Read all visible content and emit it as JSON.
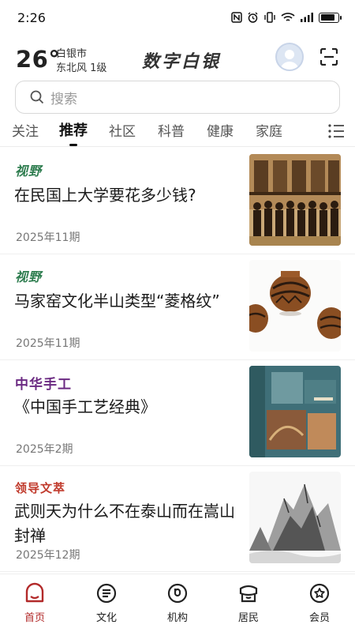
{
  "status_bar": {
    "time": "2:26",
    "icons": [
      "nfc-icon",
      "alarm-icon",
      "vibrate-icon",
      "wifi-icon",
      "signal-icon",
      "battery-icon"
    ]
  },
  "header": {
    "temperature": "26°",
    "city": "白银市",
    "wind": "东北风  1级",
    "brand": "数字白银",
    "avatar_icon": "avatar-icon",
    "scan_icon": "scan-icon"
  },
  "search": {
    "placeholder": "搜索"
  },
  "tabs": [
    {
      "label": "关注",
      "active": false
    },
    {
      "label": "推荐",
      "active": true
    },
    {
      "label": "社区",
      "active": false
    },
    {
      "label": "科普",
      "active": false
    },
    {
      "label": "健康",
      "active": false
    },
    {
      "label": "家庭",
      "active": false
    }
  ],
  "feed": [
    {
      "source": "视野",
      "source_color": "#2e7d4f",
      "title": "在民国上大学要花多少钱?",
      "date": "2025年11期",
      "thumb": "sepia-group-photo"
    },
    {
      "source": "视野",
      "source_color": "#2e7d4f",
      "title": "马家窑文化半山类型“菱格纹”",
      "date": "2025年11期",
      "thumb": "pottery-jars"
    },
    {
      "source": "中华手工",
      "source_color": "#6b2a82",
      "title": "《中国手工艺经典》",
      "date": "2025年2期",
      "thumb": "book-cover"
    },
    {
      "source": "领导文萃",
      "source_color": "#c0392b",
      "title": "武则天为什么不在泰山而在嵩山封禅",
      "date": "2025年12期",
      "thumb": "ink-mountains"
    }
  ],
  "bottom_nav": [
    {
      "label": "首页",
      "icon": "home-icon",
      "active": true
    },
    {
      "label": "文化",
      "icon": "culture-icon",
      "active": false
    },
    {
      "label": "机构",
      "icon": "organization-icon",
      "active": false
    },
    {
      "label": "居民",
      "icon": "residents-icon",
      "active": false
    },
    {
      "label": "会员",
      "icon": "member-icon",
      "active": false
    }
  ],
  "colors": {
    "accent": "#b22a2a",
    "text": "#222222",
    "divider": "#efefef"
  },
  "battery_level": 0.85
}
